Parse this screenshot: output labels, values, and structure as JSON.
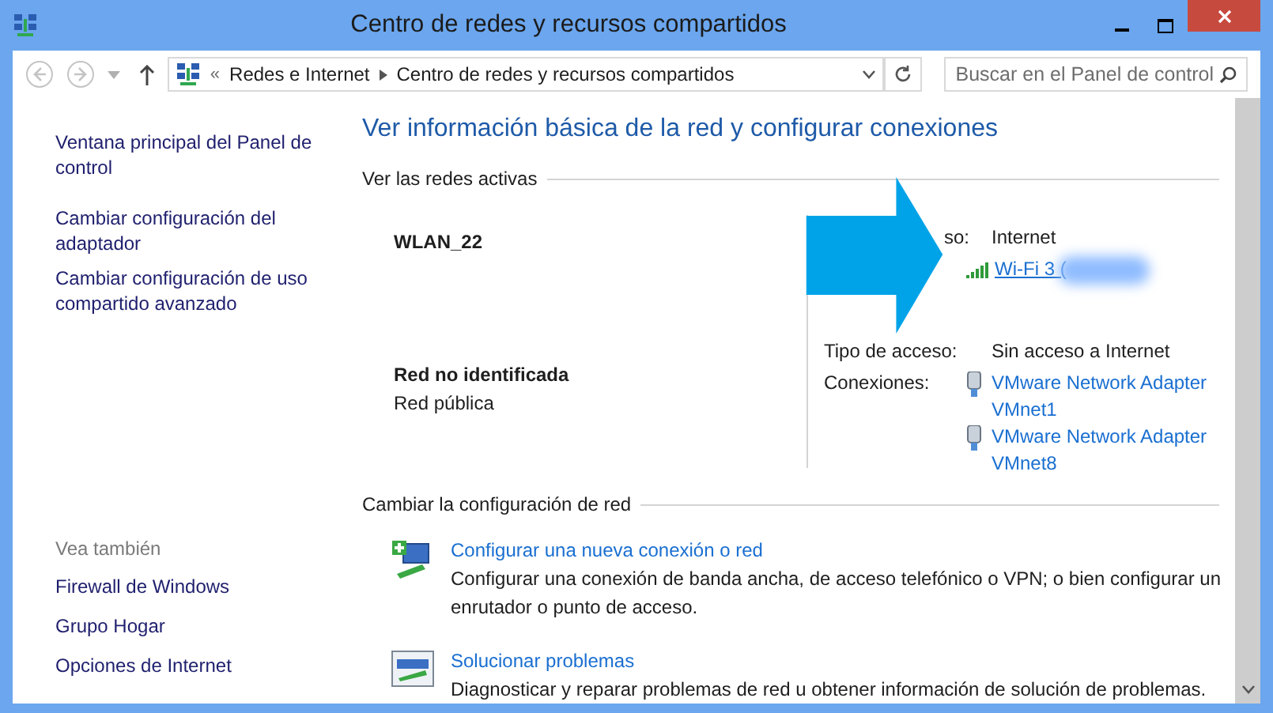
{
  "window": {
    "title": "Centro de redes y recursos compartidos"
  },
  "nav": {
    "back_disabled": true,
    "forward_disabled": true
  },
  "address": {
    "overflow": "«",
    "crumbs": [
      "Redes e Internet",
      "Centro de redes y recursos compartidos"
    ]
  },
  "search": {
    "placeholder": "Buscar en el Panel de control"
  },
  "sidebar": {
    "links": [
      "Ventana principal del Panel de control",
      "Cambiar configuración del adaptador",
      "Cambiar configuración de uso compartido avanzado"
    ],
    "see_also": {
      "heading": "Vea también",
      "links": [
        "Firewall de Windows",
        "Grupo Hogar",
        "Opciones de Internet"
      ]
    }
  },
  "main": {
    "heading": "Ver información básica de la red y configurar conexiones",
    "active_networks": {
      "heading": "Ver las redes activas",
      "networks": [
        {
          "name": "WLAN_22",
          "rows": [
            {
              "label": "so:",
              "value": "Internet",
              "links": []
            },
            {
              "label": "",
              "value": "",
              "links": [
                {
                  "kind": "wifi",
                  "text": "Wi-Fi 3 (",
                  "redacted": true
                }
              ]
            }
          ]
        },
        {
          "name": "Red no identificada",
          "subtitle": "Red pública",
          "rows": [
            {
              "label": "Tipo de acceso:",
              "value": "Sin acceso a Internet",
              "links": []
            },
            {
              "label": "Conexiones:",
              "value": "",
              "links": [
                {
                  "kind": "adapter",
                  "text": "VMware Network Adapter VMnet1",
                  "redacted": false
                },
                {
                  "kind": "adapter",
                  "text": "VMware Network Adapter VMnet8",
                  "redacted": false
                }
              ]
            }
          ]
        }
      ]
    },
    "change_settings": {
      "heading": "Cambiar la configuración de red",
      "tasks": [
        {
          "kind": "setup",
          "title": "Configurar una nueva conexión o red",
          "description": "Configurar una conexión de banda ancha, de acceso telefónico o VPN; o bien configurar un enrutador o punto de acceso."
        },
        {
          "kind": "troubleshoot",
          "title": "Solucionar problemas",
          "description": "Diagnosticar y reparar problemas de red u obtener información de solución de problemas."
        }
      ]
    }
  }
}
